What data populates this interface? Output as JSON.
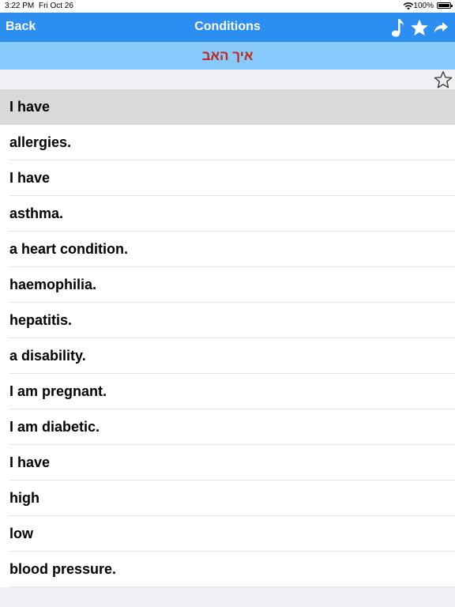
{
  "status_bar": {
    "time": "3:22 PM",
    "date": "Fri Oct 26",
    "battery": "100%"
  },
  "nav": {
    "back_label": "Back",
    "title": "Conditions",
    "icons": [
      "music-note-icon",
      "star-icon",
      "share-arrow-icon"
    ],
    "color": "#2d8ef1"
  },
  "subtitle": {
    "text": "איך האב",
    "color": "#c0281e",
    "background": "#87cafb"
  },
  "favorite_icon": "star-outline-icon",
  "phrases": [
    "I have",
    "allergies.",
    "I have",
    "asthma.",
    "a heart condition.",
    "haemophilia.",
    "hepatitis.",
    "a disability.",
    "I am pregnant.",
    "I am diabetic.",
    "I have",
    "high",
    "low",
    "blood pressure."
  ],
  "selected_index": 0
}
